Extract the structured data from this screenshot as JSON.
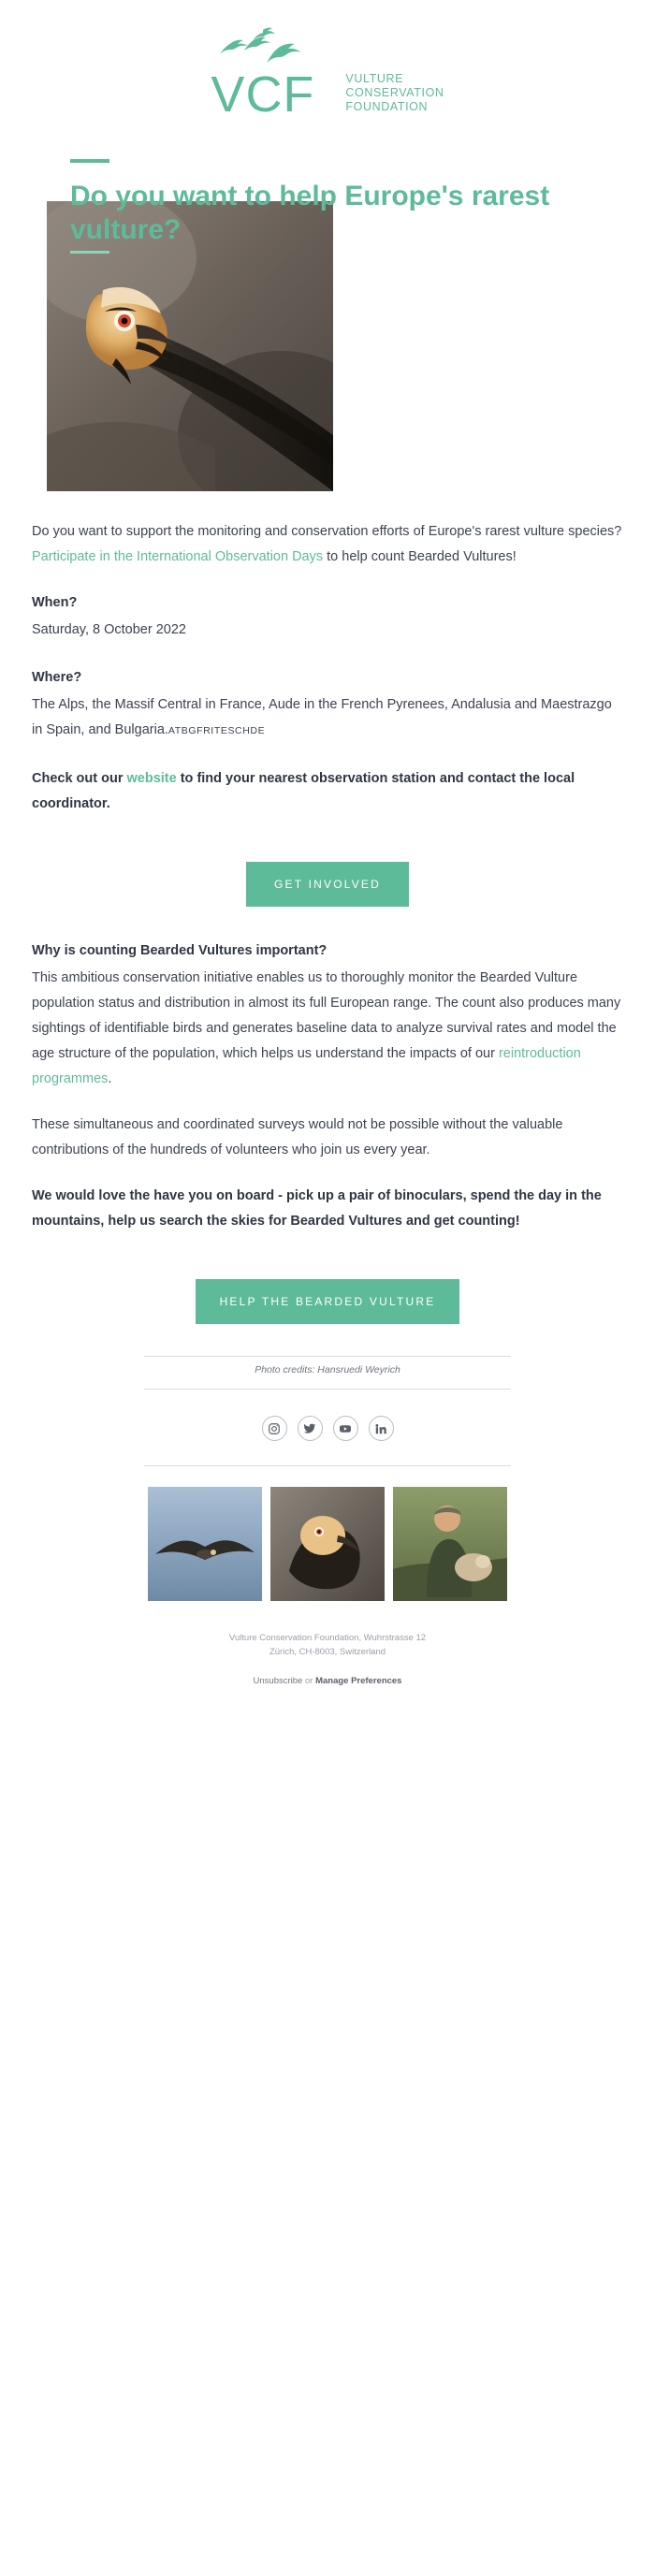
{
  "brand": {
    "accent": "#5ebb9a",
    "logo_initials": "VCF",
    "logo_words": "VULTURE\nCONSERVATION\nFOUNDATION",
    "birds_icon": "flying-vultures-icon"
  },
  "hero": {
    "headline": "Do you want to help Europe's rarest vulture?",
    "image_alt": "bearded-vulture-photo"
  },
  "body": {
    "lead_part1": "Do you want to support the monitoring and conservation efforts of Europe's rarest vulture species? ",
    "lead_link": "Participate in the International Observation Days",
    "lead_part2": " to help count Bearded Vultures!",
    "when_heading": "When?",
    "when_value": "Saturday, 8 October 2022",
    "where_heading": "Where?",
    "where_value": "The Alps, the Massif Central in France, Aude in the French Pyrenees, Andalusia and Maestrazgo in Spain, and Bulgaria.",
    "where_codes": "ATBGFRITESCHDE",
    "check_part1": "Check out our ",
    "check_link": "website",
    "check_part2": " to find your nearest observation station and contact the local coordinator."
  },
  "cta_primary": {
    "label": "GET INVOLVED"
  },
  "cta_secondary": {
    "label": "HELP THE BEARDED VULTURE"
  },
  "why": {
    "heading": "Why is counting Bearded Vultures important?",
    "para1_part1": "This ambitious conservation initiative enables us to thoroughly monitor the Bearded Vulture population status and distribution in almost its full European range. The count also produces many sightings of identifiable birds and generates baseline data to analyze survival rates and model the age structure of the population, which helps us understand the impacts of our ",
    "para1_link": "reintroduction programmes",
    "para1_part2": ".",
    "para2": "These simultaneous and coordinated surveys would not be possible without the valuable contributions of the hundreds of volunteers who join us every year.",
    "para3_bold": "We would love the have you on board - pick up a pair of binoculars, spend the day in the mountains, help us search the skies for Bearded Vultures and get counting!"
  },
  "footer": {
    "photo_credit": "Photo credits: Hansruedi Weyrich",
    "socials": [
      {
        "name": "instagram-icon",
        "label": "Instagram"
      },
      {
        "name": "twitter-icon",
        "label": "Twitter"
      },
      {
        "name": "youtube-icon",
        "label": "YouTube"
      },
      {
        "name": "linkedin-icon",
        "label": "LinkedIn"
      }
    ],
    "photos": [
      {
        "name": "footer-photo-vulture-flight"
      },
      {
        "name": "footer-photo-bearded-vulture"
      },
      {
        "name": "footer-photo-conservationist"
      }
    ],
    "address_line1": "Vulture Conservation Foundation, Wuhrstrasse 12",
    "address_line2": "Zürich, CH-8003, Switzerland",
    "unsub_text": "Unsubscribe",
    "unsub_or": " or ",
    "manage_text": "Manage Preferences"
  }
}
